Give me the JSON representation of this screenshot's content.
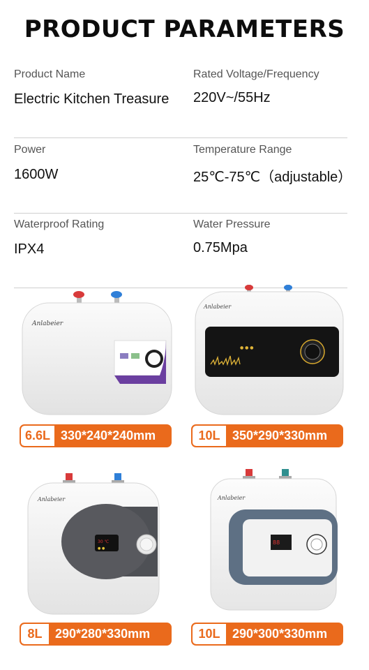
{
  "header": {
    "title": "PRODUCT PARAMETERS"
  },
  "params": [
    {
      "left": {
        "label": "Product Name",
        "value": "Electric Kitchen Treasure"
      },
      "right": {
        "label": "Rated Voltage/Frequency",
        "value": "220V~/55Hz"
      }
    },
    {
      "left": {
        "label": "Power",
        "value": "1600W"
      },
      "right": {
        "label": "Temperature Range",
        "value": "25℃-75℃（adjustable）"
      }
    },
    {
      "left": {
        "label": "Waterproof Rating",
        "value": "IPX4"
      },
      "right": {
        "label": "Water Pressure",
        "value": "0.75Mpa"
      }
    }
  ],
  "products": [
    {
      "capacity": "6.6L",
      "dimensions": "330*240*240mm",
      "brand": "Anlabeier"
    },
    {
      "capacity": "10L",
      "dimensions": "350*290*330mm",
      "brand": "Anlabeier"
    },
    {
      "capacity": "8L",
      "dimensions": "290*280*330mm",
      "brand": "Anlabeier"
    },
    {
      "capacity": "10L",
      "dimensions": "290*300*330mm",
      "brand": "Anlabeier"
    }
  ],
  "colors": {
    "accent": "#ea6a1c",
    "hot_pipe": "#d83a3a",
    "cold_pipe": "#2f7fd8",
    "purple_panel": "#6b3fa0"
  }
}
